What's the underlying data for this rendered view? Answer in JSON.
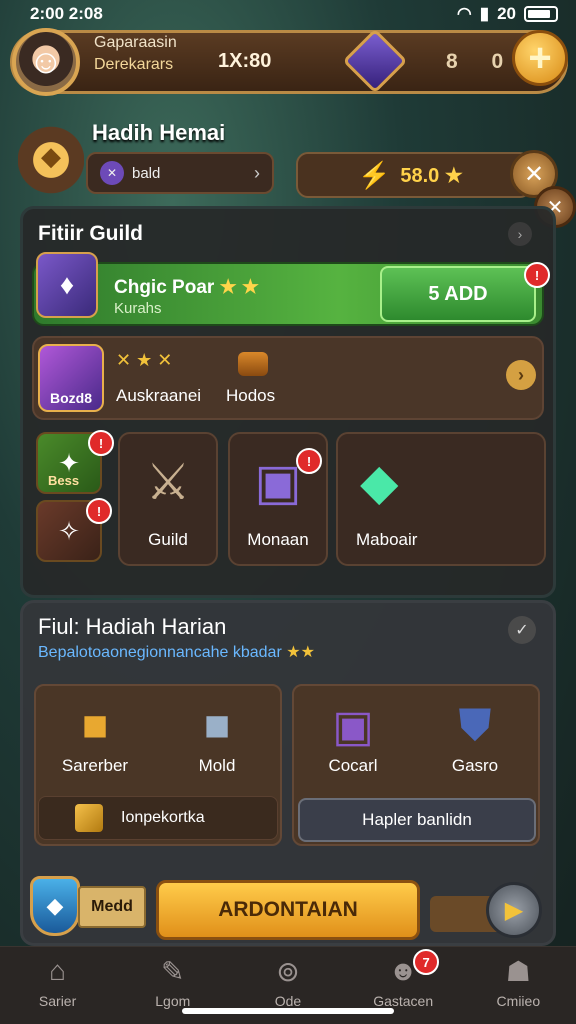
{
  "status": {
    "time": "2:00 2:08",
    "right": "20"
  },
  "header": {
    "player_name": "Gaparaasin",
    "player_sub": "Derekarars",
    "timer": "1X:80",
    "counters": "8 0",
    "plus_label": "+"
  },
  "guild_header": {
    "title": "Hadih Hemai",
    "sub_label": "bald",
    "star_value": "58.0 ★"
  },
  "panel1": {
    "title": "Fitiir Guild",
    "reward": {
      "title": "Chgic Poar",
      "stars": "★ ★",
      "subtitle": "Kurahs",
      "button": "5 ADD",
      "badge": "!"
    },
    "row": {
      "icon_label": "Bozd8",
      "stars": "✕ ★ ✕",
      "label1": "Auskraanei",
      "label2": "Hodos"
    },
    "minis": [
      {
        "label": "Bess",
        "badge": "!"
      },
      {
        "label": "",
        "badge": "!"
      }
    ],
    "cards": [
      {
        "label": "Guild"
      },
      {
        "label": "Monaan",
        "badge": "!"
      },
      {
        "label": "Maboair"
      }
    ]
  },
  "panel2": {
    "title": "Fiul: Hadiah Harian",
    "subtitle": "Bepalotoaonegionnancahe kbadar",
    "subtitle_stars": "★★",
    "left_items": [
      {
        "label": "Sarerber"
      },
      {
        "label": "Mold"
      }
    ],
    "right_items": [
      {
        "label": "Cocarl"
      },
      {
        "label": "Gasro"
      }
    ],
    "left_row": "Ionpekortka",
    "right_row": "Hapler banlidn",
    "medal": "Medd",
    "main_button": "ARDONTAIAN"
  },
  "nav": [
    {
      "label": "Sarier",
      "icon": "home-icon"
    },
    {
      "label": "Lgom",
      "icon": "chat-icon"
    },
    {
      "label": "Ode",
      "icon": "search-icon"
    },
    {
      "label": "Gastacen",
      "icon": "profile-icon",
      "badge": "7"
    },
    {
      "label": "Cmiieo",
      "icon": "ghost-icon"
    }
  ]
}
